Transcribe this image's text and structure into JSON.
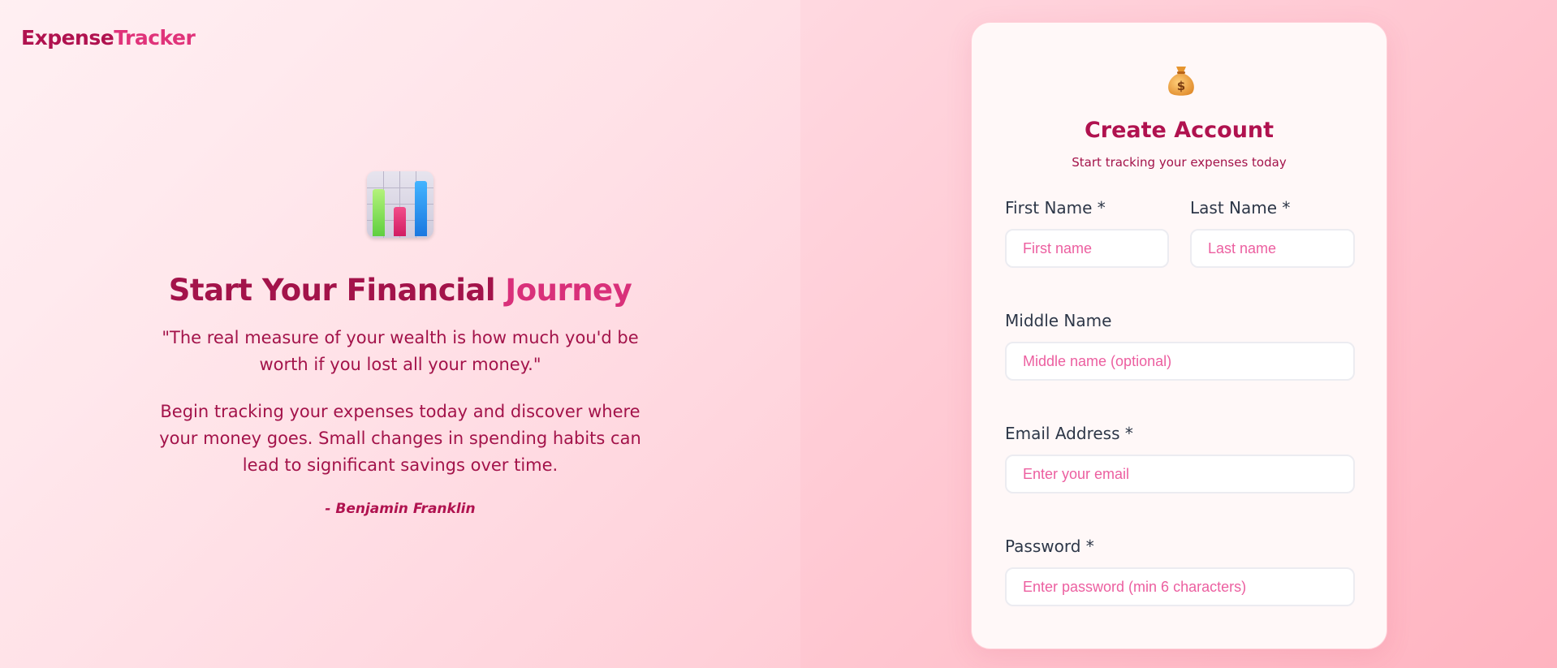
{
  "logo": {
    "part1": "Expense",
    "part2": "Tracker"
  },
  "hero": {
    "icon": "bar-chart-emoji",
    "title_part1": "Start Your Financial",
    "title_part2": "Journey",
    "quote": "\"The real measure of your wealth is how much you'd be worth if you lost all your money.\"",
    "body": "Begin tracking your expenses today and discover where your money goes. Small changes in spending habits can lead to significant savings over time.",
    "author": "- Benjamin Franklin"
  },
  "form": {
    "icon": "money-bag-emoji",
    "title": "Create Account",
    "subtitle": "Start tracking your expenses today",
    "first_name": {
      "label": "First Name *",
      "placeholder": "First name"
    },
    "last_name": {
      "label": "Last Name *",
      "placeholder": "Last name"
    },
    "middle_name": {
      "label": "Middle Name",
      "placeholder": "Middle name (optional)"
    },
    "email": {
      "label": "Email Address *",
      "placeholder": "Enter your email"
    },
    "password": {
      "label": "Password *",
      "placeholder": "Enter password (min 6 characters)"
    }
  },
  "colors": {
    "brand": "#b0124f",
    "accent": "#e0337a",
    "placeholder": "#ec5fa0",
    "label": "#2d3748"
  }
}
